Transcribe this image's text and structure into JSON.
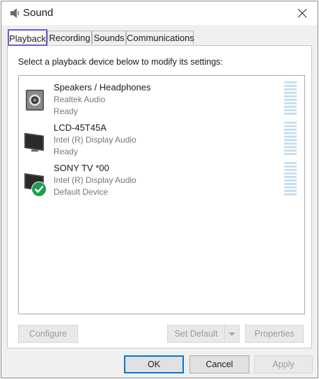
{
  "window": {
    "title": "Sound",
    "icon": "speaker-icon",
    "close_icon": "close-icon"
  },
  "tabs": [
    {
      "label": "Playback",
      "active": true
    },
    {
      "label": "Recording",
      "active": false
    },
    {
      "label": "Sounds",
      "active": false
    },
    {
      "label": "Communications",
      "active": false
    }
  ],
  "playback": {
    "instructions": "Select a playback device below to modify its settings:",
    "devices": [
      {
        "name": "Speakers / Headphones",
        "driver": "Realtek Audio",
        "status": "Ready",
        "icon": "speaker-device-icon",
        "is_default": false
      },
      {
        "name": "LCD-45T45A",
        "driver": "Intel (R) Display Audio",
        "status": "Ready",
        "icon": "monitor-device-icon",
        "is_default": false
      },
      {
        "name": "SONY TV  *00",
        "driver": "Intel (R) Display Audio",
        "status": "Default Device",
        "icon": "monitor-device-icon",
        "is_default": true,
        "badge_icon": "default-check-icon"
      }
    ],
    "buttons": {
      "configure": "Configure",
      "set_default": "Set Default",
      "properties": "Properties"
    }
  },
  "footer": {
    "ok": "OK",
    "cancel": "Cancel",
    "apply": "Apply"
  },
  "colors": {
    "accent": "#0078d7",
    "active_tab_border": "#6a5acd",
    "default_badge": "#1e9e4e",
    "level_meter": "#c7dff0"
  }
}
